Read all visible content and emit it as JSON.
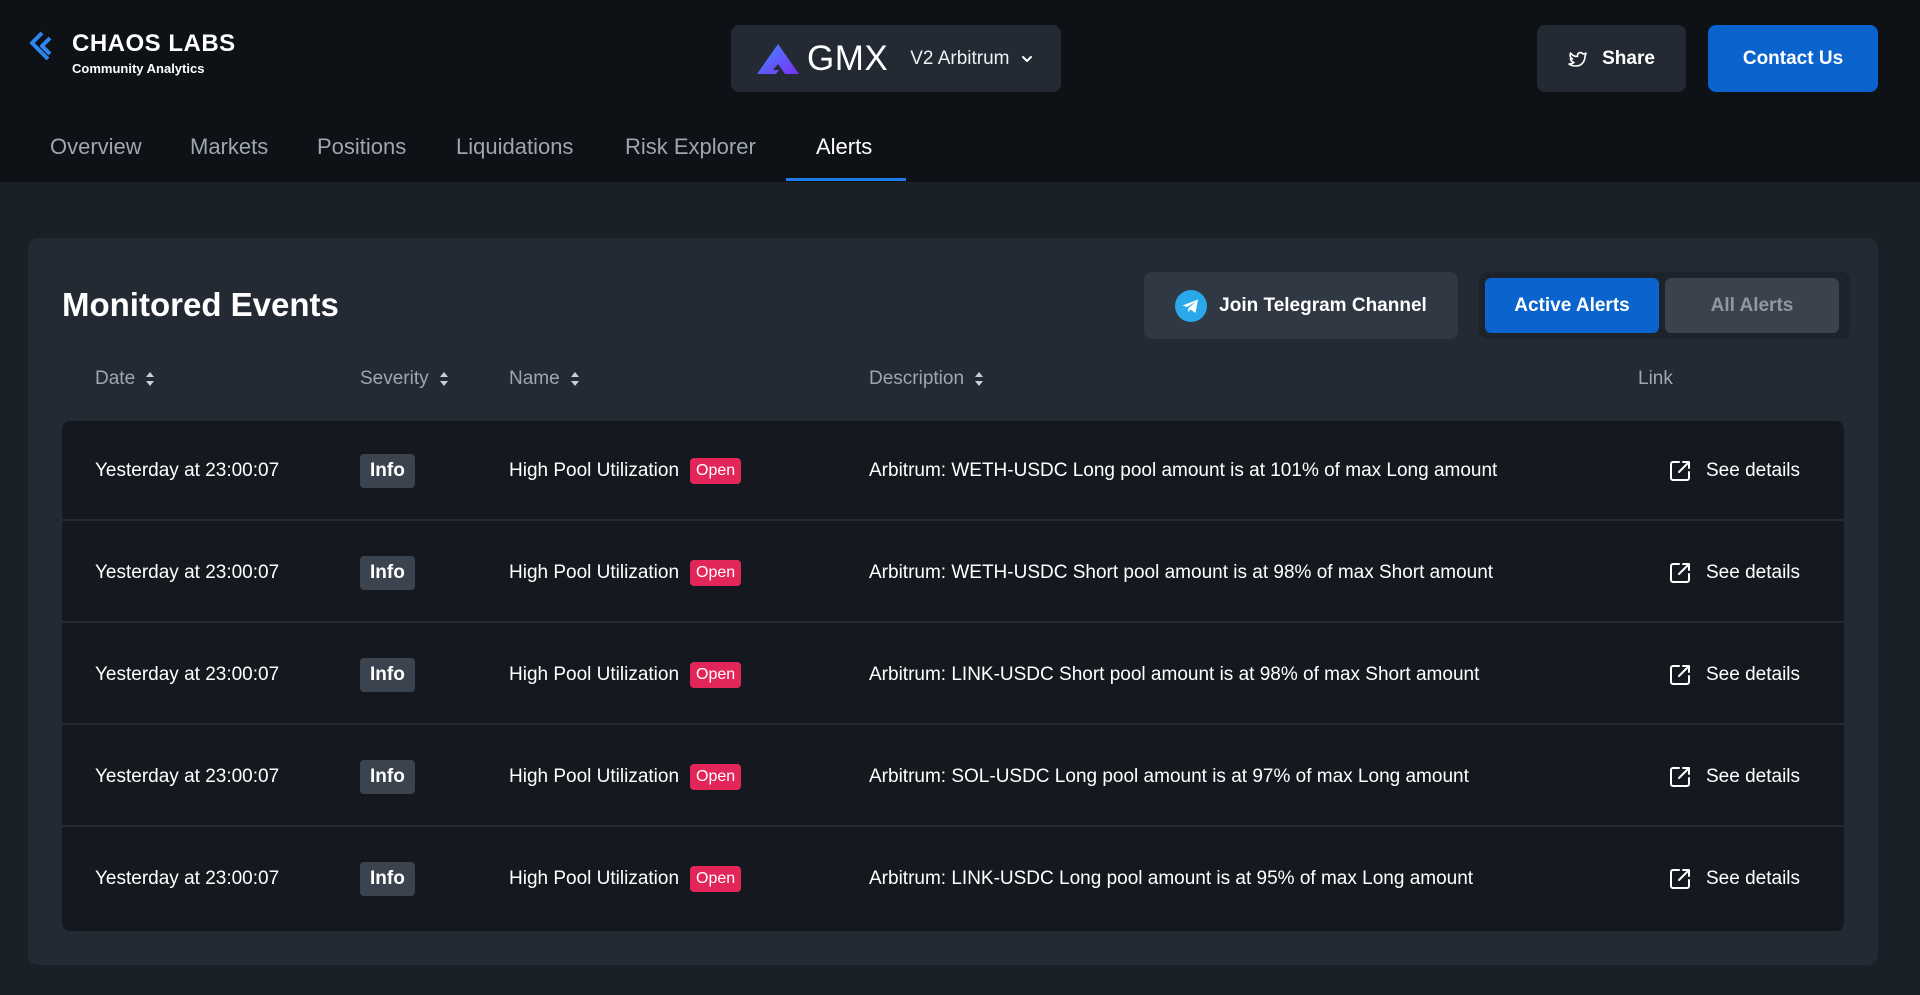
{
  "brand": {
    "name": "CHAOS LABS",
    "subtitle": "Community Analytics"
  },
  "protocol": {
    "name": "GMX",
    "network": "V2 Arbitrum"
  },
  "header_buttons": {
    "share": "Share",
    "contact": "Contact Us"
  },
  "nav": {
    "items": [
      "Overview",
      "Markets",
      "Positions",
      "Liquidations",
      "Risk Explorer",
      "Alerts"
    ],
    "active": "Alerts"
  },
  "panel": {
    "title": "Monitored Events",
    "telegram_button": "Join Telegram Channel",
    "toggle": {
      "active": "Active Alerts",
      "all": "All Alerts"
    }
  },
  "table": {
    "headers": {
      "date": "Date",
      "severity": "Severity",
      "name": "Name",
      "description": "Description",
      "link": "Link"
    },
    "rows": [
      {
        "date": "Yesterday at 23:00:07",
        "severity": "Info",
        "name": "High Pool Utilization",
        "status": "Open",
        "description": "Arbitrum: WETH-USDC Long pool amount is at 101% of max Long amount",
        "link": "See details"
      },
      {
        "date": "Yesterday at 23:00:07",
        "severity": "Info",
        "name": "High Pool Utilization",
        "status": "Open",
        "description": "Arbitrum: WETH-USDC Short pool amount is at 98% of max Short amount",
        "link": "See details"
      },
      {
        "date": "Yesterday at 23:00:07",
        "severity": "Info",
        "name": "High Pool Utilization",
        "status": "Open",
        "description": "Arbitrum: LINK-USDC Short pool amount is at 98% of max Short amount",
        "link": "See details"
      },
      {
        "date": "Yesterday at 23:00:07",
        "severity": "Info",
        "name": "High Pool Utilization",
        "status": "Open",
        "description": "Arbitrum: SOL-USDC Long pool amount is at 97% of max Long amount",
        "link": "See details"
      },
      {
        "date": "Yesterday at 23:00:07",
        "severity": "Info",
        "name": "High Pool Utilization",
        "status": "Open",
        "description": "Arbitrum: LINK-USDC Long pool amount is at 95% of max Long amount",
        "link": "See details"
      }
    ]
  },
  "colors": {
    "accent": "#0b63ce",
    "open_badge": "#e3265a",
    "background": "#1a2028"
  }
}
